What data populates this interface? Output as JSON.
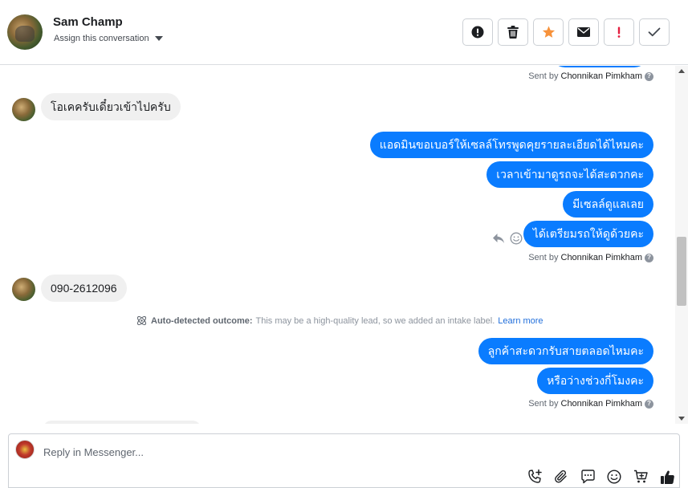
{
  "header": {
    "contact_name": "Sam Champ",
    "assign_label": "Assign this conversation",
    "actions": [
      {
        "icon": "exclamation-circle-icon"
      },
      {
        "icon": "trash-icon"
      },
      {
        "icon": "star-icon",
        "color": "#f7923b"
      },
      {
        "icon": "envelope-icon"
      },
      {
        "icon": "exclamation-icon",
        "color": "#e41e3f"
      },
      {
        "icon": "check-icon"
      }
    ]
  },
  "thread": {
    "messages": [
      {
        "direction": "out",
        "text": ""
      },
      {
        "direction": "meta",
        "sent_by_prefix": "Sent by",
        "sent_by_name": "Chonnikan Pimkham"
      },
      {
        "direction": "in",
        "text": "โอเคครับเดี๋ยวเข้าไปครับ"
      },
      {
        "direction": "out",
        "text": "แอดมินขอเบอร์ให้เซลล์โทรพูดคุยรายละเอียดได้ไหมคะ"
      },
      {
        "direction": "out",
        "text": "เวลาเข้ามาดูรถจะได้สะดวกคะ"
      },
      {
        "direction": "out",
        "text": "มีเซลล์ดูแลเลย"
      },
      {
        "direction": "out",
        "text": "ได้เตรียมรถให้ดูด้วยคะ"
      },
      {
        "direction": "meta",
        "sent_by_prefix": "Sent by",
        "sent_by_name": "Chonnikan Pimkham"
      },
      {
        "direction": "in",
        "text": "090-2612096"
      },
      {
        "direction": "system",
        "label": "Auto-detected outcome:",
        "text": "This may be a high-quality lead, so we added an intake label.",
        "link": "Learn more"
      },
      {
        "direction": "out",
        "text": "ลูกค้าสะดวกรับสายตลอดไหมคะ"
      },
      {
        "direction": "out",
        "text": "หรือว่างช่วงกี่โมงคะ"
      },
      {
        "direction": "meta",
        "sent_by_prefix": "Sent by",
        "sent_by_name": "Chonnikan Pimkham"
      }
    ]
  },
  "composer": {
    "placeholder": "Reply in Messenger...",
    "tools": [
      "phone-add-icon",
      "paperclip-icon",
      "saved-reply-icon",
      "emoji-icon",
      "cart-add-icon",
      "thumbs-up-icon"
    ]
  },
  "colors": {
    "outgoing_bubble": "#0a7cff",
    "incoming_bubble": "#f0f0f0",
    "link": "#216fdb"
  }
}
